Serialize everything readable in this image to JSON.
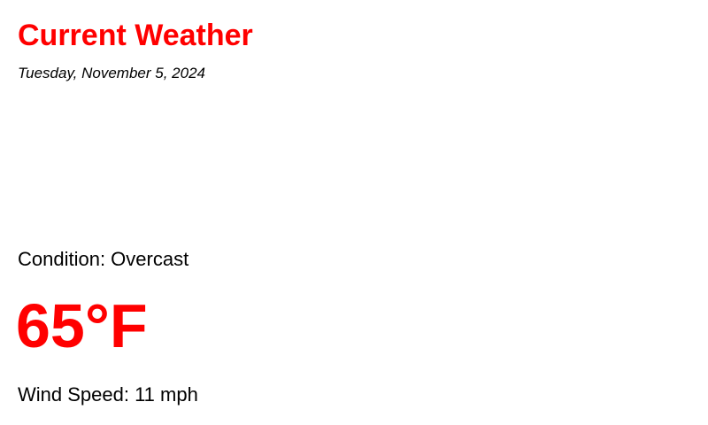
{
  "weather": {
    "title": "Current Weather",
    "date": "Tuesday, November 5, 2024",
    "condition_text": "Condition: Overcast",
    "temperature_text": "65°F",
    "wind_text": "Wind Speed: 11 mph"
  },
  "colors": {
    "accent": "#ff0000",
    "text": "#000000",
    "background": "#ffffff"
  }
}
